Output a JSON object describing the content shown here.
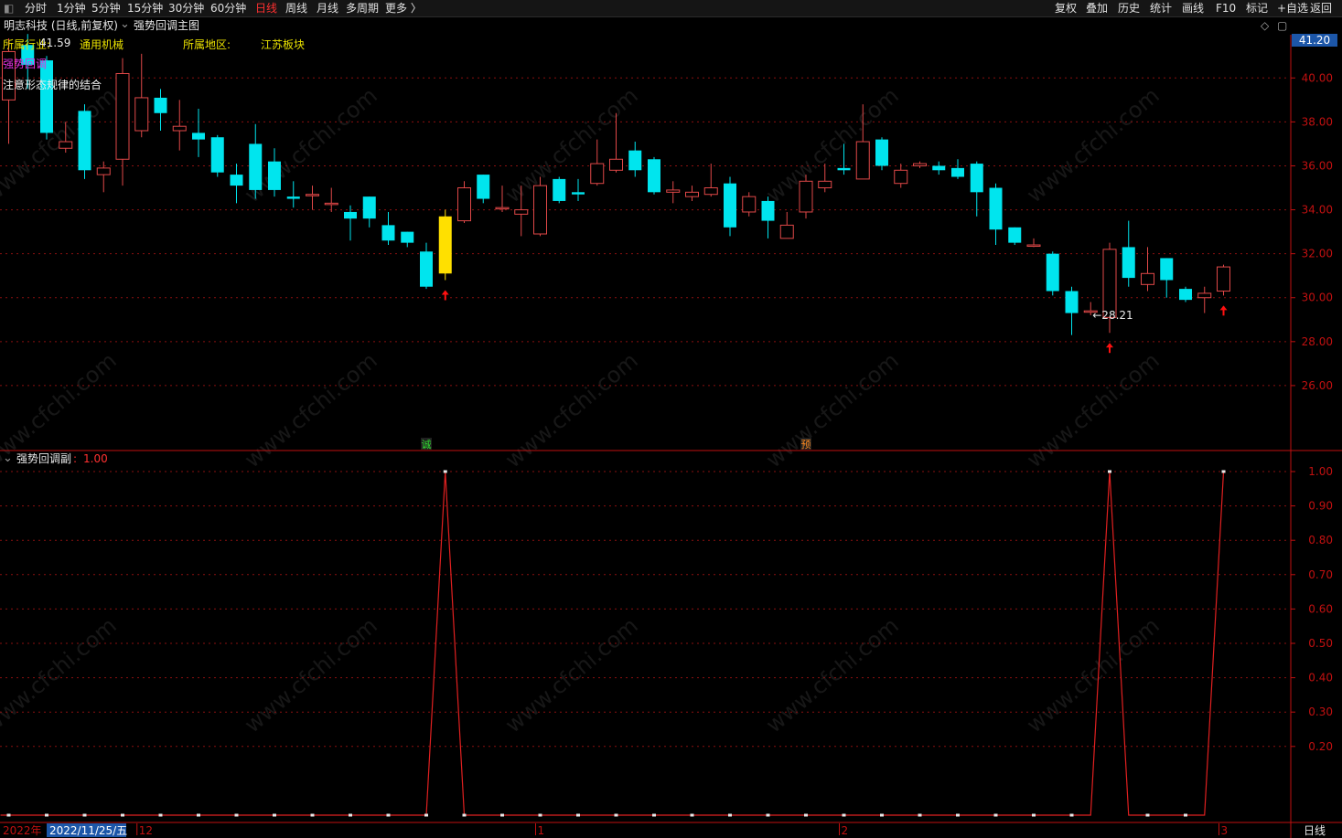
{
  "toolbar": {
    "periods": [
      "分时",
      "1分钟",
      "5分钟",
      "15分钟",
      "30分钟",
      "60分钟",
      "日线",
      "周线",
      "月线",
      "多周期",
      "更多 〉"
    ],
    "active_period": "日线",
    "right_buttons": [
      "复权",
      "叠加",
      "历史",
      "统计",
      "画线",
      "F10",
      "标记",
      "+自选",
      "返回"
    ]
  },
  "title": {
    "stock": "明志科技 (日线,前复权)",
    "indicator": "强势回调主图"
  },
  "info": {
    "industry_label": "所属行业:",
    "industry_value": "通用机械",
    "region_label": "所属地区:",
    "region_value": "江苏板块",
    "overlay_value": "41.59",
    "indicator_name": "强势回调",
    "note": "注意形态规律的结合"
  },
  "price_axis": {
    "current_price": "41.20",
    "ticks": [
      "40.00",
      "38.00",
      "36.00",
      "34.00",
      "32.00",
      "30.00",
      "28.00",
      "26.00"
    ],
    "ylim": [
      24.0,
      42.3
    ]
  },
  "sub_panel": {
    "title": "强势回调副",
    "value": "1.00",
    "ticks": [
      "1.00",
      "0.90",
      "0.80",
      "0.70",
      "0.60",
      "0.50",
      "0.40",
      "0.30",
      "0.20"
    ],
    "ylim": [
      0.0,
      1.0
    ]
  },
  "date_axis": {
    "year_label": "2022年",
    "cursor_date": "2022/11/25/五",
    "month_labels": [
      {
        "label": "12",
        "index": 7
      },
      {
        "label": "1",
        "index": 28
      },
      {
        "label": "2",
        "index": 44
      },
      {
        "label": "3",
        "index": 64
      }
    ],
    "period_tag": "日线"
  },
  "annotations": {
    "low_label": "28.21",
    "low_index": 57,
    "signal_labels": [
      {
        "text": "诚",
        "index": 22
      },
      {
        "text": "预",
        "index": 42
      }
    ],
    "buy_arrow_indices": [
      23,
      58,
      64
    ]
  },
  "watermark": "www.cfchi.com",
  "colors": {
    "up": "#e04848",
    "down": "#00e5ee",
    "highlight": "#ffe000",
    "grid": "#8a1010",
    "axis": "#c01010",
    "text_yellow": "#e8e000",
    "text_magenta": "#e030e0",
    "line": "#e02020"
  },
  "chart_data": {
    "type": "candlestick",
    "candles": [
      [
        39.0,
        41.2,
        37.0,
        41.8
      ],
      [
        41.5,
        40.6,
        39.5,
        42.0
      ],
      [
        40.8,
        37.5,
        37.2,
        41.0
      ],
      [
        36.8,
        37.1,
        36.6,
        38.0
      ],
      [
        38.5,
        35.8,
        35.4,
        38.8
      ],
      [
        35.6,
        35.9,
        34.8,
        36.2
      ],
      [
        36.3,
        40.2,
        35.1,
        40.9
      ],
      [
        37.6,
        39.1,
        37.3,
        41.1
      ],
      [
        39.1,
        38.4,
        37.6,
        39.5
      ],
      [
        37.6,
        37.8,
        36.7,
        39.0
      ],
      [
        37.5,
        37.2,
        36.4,
        38.6
      ],
      [
        37.3,
        35.7,
        35.5,
        37.4
      ],
      [
        35.6,
        35.1,
        34.3,
        36.1
      ],
      [
        37.0,
        34.9,
        34.5,
        37.9
      ],
      [
        36.2,
        34.9,
        34.6,
        36.8
      ],
      [
        34.6,
        34.5,
        34.1,
        35.3
      ],
      [
        34.7,
        34.7,
        34.0,
        35.1
      ],
      [
        34.3,
        34.3,
        33.9,
        35.0
      ],
      [
        33.9,
        33.6,
        32.6,
        34.2
      ],
      [
        34.6,
        33.6,
        33.2,
        34.6
      ],
      [
        33.3,
        32.6,
        32.4,
        33.9
      ],
      [
        33.0,
        32.5,
        32.3,
        33.0
      ],
      [
        32.1,
        30.5,
        30.4,
        32.5
      ],
      [
        31.1,
        33.7,
        30.8,
        34.0
      ],
      [
        33.5,
        35.0,
        33.4,
        35.3
      ],
      [
        35.6,
        34.5,
        34.3,
        35.6
      ],
      [
        34.1,
        34.1,
        33.9,
        35.1
      ],
      [
        33.8,
        34.0,
        32.8,
        35.1
      ],
      [
        32.9,
        35.1,
        32.8,
        35.5
      ],
      [
        35.4,
        34.4,
        34.3,
        35.5
      ],
      [
        34.8,
        34.7,
        34.4,
        35.4
      ],
      [
        35.2,
        36.1,
        35.1,
        37.2
      ],
      [
        35.8,
        36.3,
        35.7,
        38.4
      ],
      [
        36.7,
        35.8,
        35.5,
        37.1
      ],
      [
        36.3,
        34.8,
        34.7,
        36.4
      ],
      [
        34.8,
        34.9,
        34.3,
        35.3
      ],
      [
        34.6,
        34.8,
        34.4,
        35.1
      ],
      [
        34.7,
        35.0,
        34.6,
        36.1
      ],
      [
        35.2,
        33.2,
        32.8,
        35.5
      ],
      [
        33.9,
        34.6,
        33.7,
        34.8
      ],
      [
        34.4,
        33.5,
        32.7,
        34.6
      ],
      [
        32.7,
        33.3,
        32.7,
        33.9
      ],
      [
        33.9,
        35.3,
        33.6,
        35.6
      ],
      [
        35.0,
        35.3,
        34.8,
        36.1
      ],
      [
        35.9,
        35.8,
        35.6,
        37.0
      ],
      [
        35.4,
        37.1,
        35.5,
        38.8
      ],
      [
        37.2,
        36.0,
        35.8,
        37.3
      ],
      [
        35.2,
        35.8,
        35.0,
        36.1
      ],
      [
        36.0,
        36.1,
        35.9,
        36.2
      ],
      [
        36.0,
        35.8,
        35.6,
        36.2
      ],
      [
        35.9,
        35.5,
        35.4,
        36.3
      ],
      [
        36.1,
        34.8,
        33.7,
        36.2
      ],
      [
        35.0,
        33.1,
        32.4,
        35.2
      ],
      [
        33.2,
        32.5,
        32.4,
        33.2
      ],
      [
        32.4,
        32.4,
        32.3,
        32.7
      ],
      [
        32.0,
        30.3,
        30.1,
        32.1
      ],
      [
        30.3,
        29.3,
        28.3,
        30.5
      ],
      [
        29.4,
        29.4,
        29.2,
        29.8
      ],
      [
        29.1,
        32.2,
        28.4,
        32.5
      ],
      [
        32.3,
        30.9,
        30.5,
        33.5
      ],
      [
        30.6,
        31.1,
        30.3,
        32.3
      ],
      [
        31.8,
        30.8,
        30.0,
        31.8
      ],
      [
        30.4,
        29.9,
        29.8,
        30.5
      ],
      [
        30.0,
        30.2,
        29.3,
        30.5
      ],
      [
        30.3,
        31.4,
        30.1,
        31.5
      ]
    ],
    "highlight_index": 23,
    "sub_series": [
      0,
      0,
      0,
      0,
      0,
      0,
      0,
      0,
      0,
      0,
      0,
      0,
      0,
      0,
      0,
      0,
      0,
      0,
      0,
      0,
      0,
      0,
      0,
      1,
      0,
      0,
      0,
      0,
      0,
      0,
      0,
      0,
      0,
      0,
      0,
      0,
      0,
      0,
      0,
      0,
      0,
      0,
      0,
      0,
      0,
      0,
      0,
      0,
      0,
      0,
      0,
      0,
      0,
      0,
      0,
      0,
      0,
      0,
      1,
      0,
      0,
      0,
      0,
      0,
      1
    ]
  }
}
